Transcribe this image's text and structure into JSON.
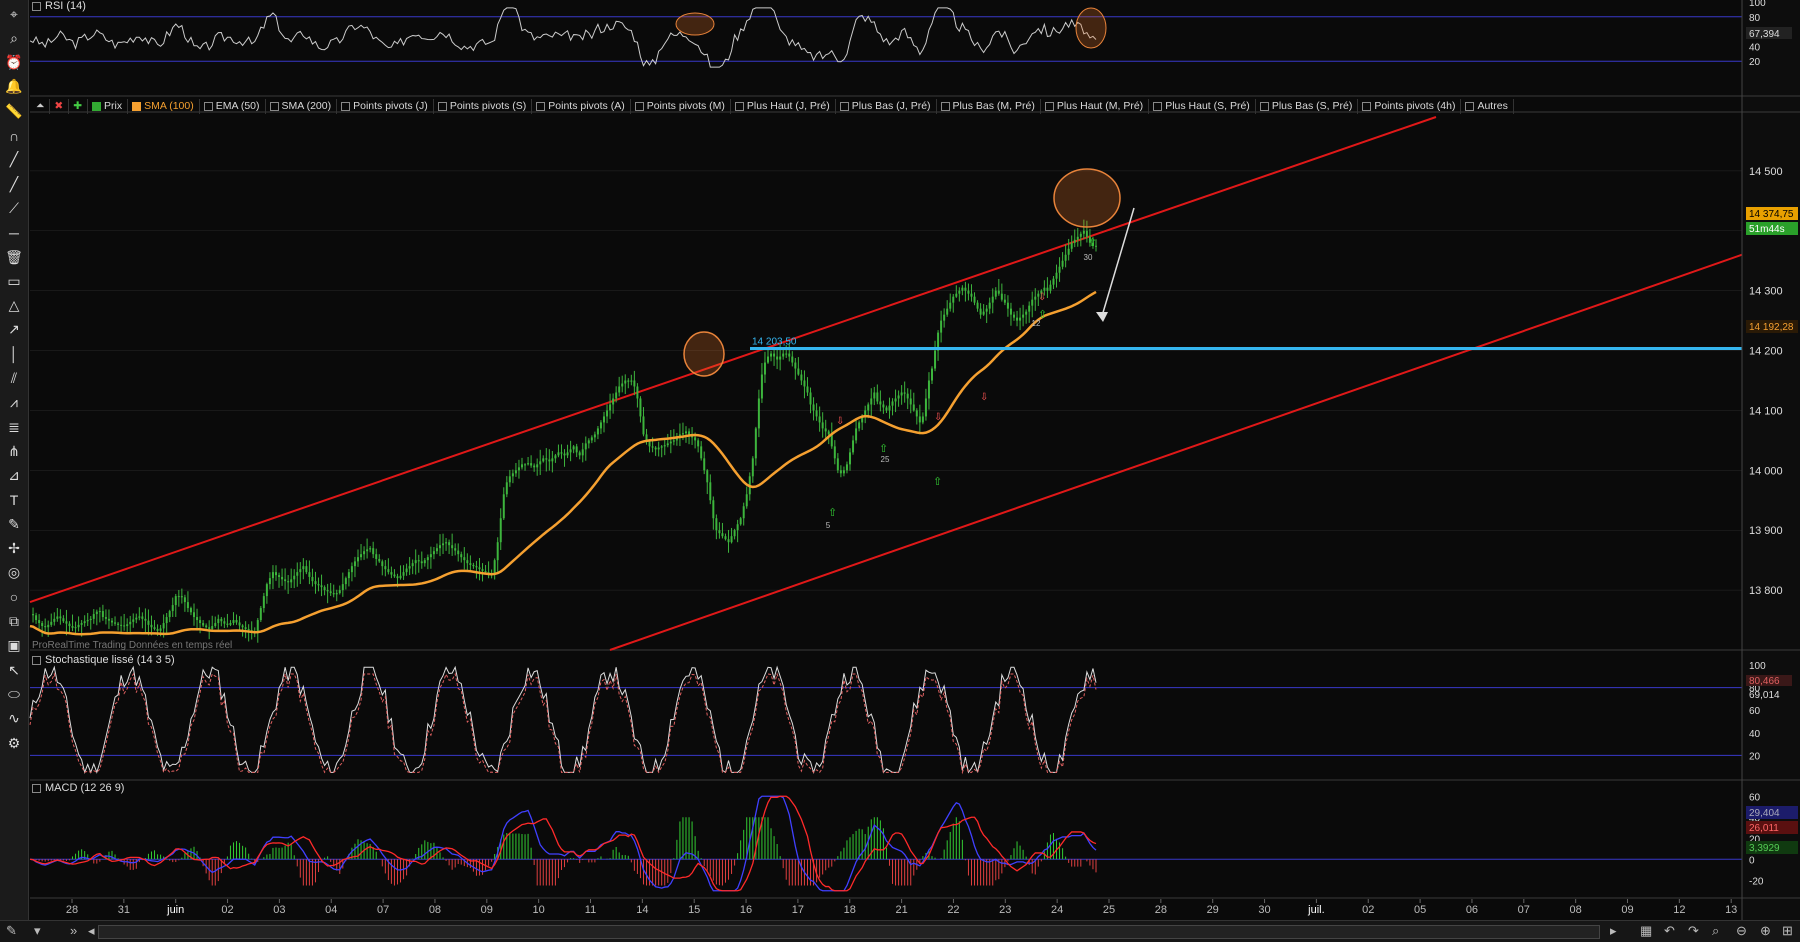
{
  "app": {
    "watermark": "ProRealTime Trading  Données en temps réel"
  },
  "toolbar": {
    "icons": [
      "pointer-icon",
      "magnifier-icon",
      "alarm-icon",
      "bell-icon",
      "ruler-icon",
      "magnet-icon",
      "line-icon",
      "trend-line-icon",
      "ray-icon",
      "horizontal-line-icon",
      "trash-icon",
      "rectangle-icon",
      "triangle-icon",
      "arrow-icon",
      "vertical-line-icon",
      "channel-icon",
      "zigzag-icon",
      "fibonacci-icon",
      "pitchfork-icon",
      "gann-icon",
      "text-icon",
      "brush-icon",
      "cross-icon",
      "spiral-icon",
      "circle-icon",
      "copy-icon",
      "label-icon",
      "cursor-icon",
      "ellipse-icon",
      "wave-icon",
      "settings-icon"
    ]
  },
  "legend": [
    {
      "label": "Prix",
      "on": "green"
    },
    {
      "label": "SMA (100)",
      "on": "orange"
    },
    {
      "label": "EMA (50)",
      "on": ""
    },
    {
      "label": "SMA (200)",
      "on": ""
    },
    {
      "label": "Points pivots (J)",
      "on": ""
    },
    {
      "label": "Points pivots (S)",
      "on": ""
    },
    {
      "label": "Points pivots (A)",
      "on": ""
    },
    {
      "label": "Points pivots (M)",
      "on": ""
    },
    {
      "label": "Plus Haut (J, Pré)",
      "on": ""
    },
    {
      "label": "Plus Bas (J, Pré)",
      "on": ""
    },
    {
      "label": "Plus Bas (M, Pré)",
      "on": ""
    },
    {
      "label": "Plus Haut (M, Pré)",
      "on": ""
    },
    {
      "label": "Plus Haut (S, Pré)",
      "on": ""
    },
    {
      "label": "Plus Bas (S, Pré)",
      "on": ""
    },
    {
      "label": "Points pivots (4h)",
      "on": ""
    },
    {
      "label": "Autres",
      "on": ""
    }
  ],
  "colors": {
    "bg": "#0a0a0a",
    "grid": "#2a2a2a",
    "channel": "#e01818",
    "sma": "#f5a030",
    "resistance": "#35b6f0",
    "candle": "#3db53d",
    "rsi": "#cccccc",
    "band": "#3838c8"
  },
  "chart_data": [
    {
      "id": "price",
      "type": "line",
      "title": "",
      "ylim": [
        13700,
        14590
      ],
      "yticks": [
        "14 500",
        "14 400",
        "14 300",
        "14 200",
        "14 100",
        "14 000",
        "13 900",
        "13 800"
      ],
      "ytick_values": [
        14500,
        14400,
        14300,
        14200,
        14100,
        14000,
        13900,
        13800
      ],
      "xlabels": [
        "28",
        "31",
        "juin",
        "02",
        "03",
        "04",
        "07",
        "08",
        "09",
        "10",
        "11",
        "14",
        "15",
        "16",
        "17",
        "18",
        "21",
        "22",
        "23",
        "24",
        "25",
        "28",
        "29",
        "30",
        "juil.",
        "02",
        "05",
        "06",
        "07",
        "08",
        "09",
        "12",
        "13"
      ],
      "series": [
        {
          "name": "Prix",
          "type": "candlestick",
          "x": [
            0,
            1,
            2,
            3,
            4,
            5,
            6,
            7,
            8,
            9,
            10,
            11,
            12,
            13,
            14,
            15,
            16,
            17,
            18,
            19,
            20,
            21,
            22,
            23,
            24,
            25,
            26,
            27,
            28,
            29,
            30,
            31,
            32,
            33,
            34,
            35,
            36,
            37,
            38,
            39,
            40,
            41,
            42,
            43,
            44,
            45,
            46,
            47,
            48,
            49,
            50,
            51,
            52,
            53,
            54,
            55,
            56,
            57,
            58,
            59,
            60,
            61,
            62,
            63,
            64,
            65,
            66,
            67,
            68,
            69,
            70,
            71,
            72,
            73,
            74,
            75,
            76,
            77,
            78,
            79,
            80,
            81,
            82,
            83,
            84,
            85,
            86,
            87,
            88,
            89,
            90,
            91,
            92,
            93,
            94,
            95,
            96,
            97,
            98,
            99,
            100,
            101,
            102,
            103,
            104,
            105,
            106,
            107,
            108,
            109,
            110,
            111,
            112,
            113,
            114,
            115,
            116,
            117,
            118,
            119,
            120,
            121,
            122,
            123,
            124,
            125,
            126,
            127,
            128,
            129,
            130,
            131,
            132,
            133,
            134,
            135,
            136,
            137,
            138,
            139,
            140,
            141,
            142,
            143,
            144,
            145,
            146,
            147,
            148,
            149,
            150,
            151,
            152,
            153,
            154,
            155,
            156,
            157,
            158,
            159,
            160,
            161,
            162,
            163,
            164,
            165,
            166,
            167,
            168,
            169,
            170,
            171,
            172,
            173,
            174,
            175,
            176,
            177,
            178,
            179,
            180,
            181,
            182,
            183,
            184,
            185,
            186,
            187,
            188,
            189,
            190,
            191,
            192,
            193,
            194,
            195,
            196,
            197,
            198,
            199,
            200,
            201,
            202,
            203,
            204,
            205,
            206,
            207,
            208,
            209,
            210,
            211,
            212,
            213,
            214,
            215,
            216,
            217,
            218,
            219,
            220,
            221,
            222,
            223,
            224,
            225,
            226,
            227,
            228,
            229,
            230,
            231,
            232,
            233,
            234,
            235,
            236,
            237,
            238,
            239,
            240,
            241,
            242,
            243,
            244,
            245,
            246,
            247,
            248,
            249,
            250,
            251,
            252,
            253,
            254,
            255,
            256,
            257,
            258,
            259,
            260,
            261,
            262,
            263,
            264,
            265,
            266,
            267,
            268,
            269,
            270,
            271,
            272,
            273,
            274,
            275,
            276,
            277,
            278,
            279,
            280,
            281,
            282,
            283,
            284,
            285,
            286,
            287,
            288,
            289,
            290,
            291,
            292,
            293,
            294,
            295,
            296,
            297,
            298,
            299,
            300,
            301,
            302,
            303,
            304,
            305,
            306,
            307,
            308,
            309,
            310,
            311,
            312,
            313,
            314,
            315,
            316,
            317,
            318,
            319,
            320,
            321,
            322,
            323,
            324,
            325,
            326,
            327,
            328,
            329,
            330,
            331,
            332,
            333,
            334,
            335,
            336,
            337,
            338,
            339,
            340,
            341,
            342,
            343,
            344,
            345,
            346,
            347,
            348,
            349,
            350,
            351,
            352,
            353,
            354,
            355,
            356,
            357,
            358,
            359,
            360,
            361,
            362,
            363,
            364,
            365,
            366,
            367,
            368,
            369,
            370,
            371,
            372,
            373,
            374,
            375,
            376,
            377,
            378,
            379,
            380,
            381,
            382,
            383,
            384,
            385,
            386,
            387,
            388,
            389,
            390,
            391,
            392,
            393,
            394,
            395,
            396,
            397,
            398,
            399,
            400
          ],
          "close": [
            13760,
            13758,
            13750,
            13745,
            13740,
            13738,
            13742,
            13747,
            13752,
            13756,
            13753,
            13748,
            13744,
            13740,
            13737,
            13738,
            13742,
            13745,
            13748,
            13750,
            13752,
            13760,
            13764,
            13765,
            13755,
            13752,
            13749,
            13746,
            13744,
            13742,
            13741,
            13740,
            13743,
            13747,
            13751,
            13754,
            13756,
            13752,
            13749,
            13742,
            13738,
            13735,
            13732,
            13736,
            13745,
            13755,
            13765,
            13775,
            13790,
            13790,
            13788,
            13780,
            13770,
            13763,
            13755,
            13750,
            13745,
            13741,
            13738,
            13735,
            13740,
            13745,
            13752,
            13748,
            13744,
            13742,
            13745,
            13750,
            13746,
            13741,
            13738,
            13735,
            13733,
            13731,
            13730,
            13750,
            13770,
            13790,
            13810,
            13820,
            13830,
            13825,
            13822,
            13818,
            13815,
            13813,
            13818,
            13824,
            13830,
            13835,
            13840,
            13830,
            13822,
            13815,
            13810,
            13808,
            13805,
            13800,
            13798,
            13795,
            13793,
            13795,
            13800,
            13810,
            13820,
            13830,
            13840,
            13848,
            13855,
            13860,
            13865,
            13868,
            13870,
            13860,
            13852,
            13848,
            13840,
            13835,
            13830,
            13826,
            13823,
            13820,
            13824,
            13830,
            13836,
            13840,
            13845,
            13850,
            13848,
            13845,
            13850,
            13855,
            13860,
            13865,
            13870,
            13875,
            13878,
            13880,
            13875,
            13870,
            13866,
            13860,
            13855,
            13850,
            13845,
            13842,
            13840,
            13838,
            13835,
            13832,
            13830,
            13828,
            13826,
            13850,
            13880,
            13920,
            13960,
            13980,
            13990,
            13995,
            14000,
            14005,
            14010,
            14010,
            14012,
            14008,
            14005,
            14010,
            14015,
            14020,
            14018,
            14015,
            14020,
            14025,
            14030,
            14028,
            14025,
            14030,
            14035,
            14040,
            14030,
            14025,
            14035,
            14045,
            14050,
            14055,
            14060,
            14070,
            14080,
            14090,
            14100,
            14110,
            14120,
            14130,
            14140,
            14145,
            14150,
            14148,
            14150,
            14140,
            14120,
            14090,
            14060,
            14050,
            14040,
            14038,
            14035,
            14038,
            14040,
            14042,
            14045,
            14048,
            14050,
            14055,
            14060,
            14062,
            14065,
            14060,
            14055,
            14050,
            14040,
            14020,
            14000,
            13980,
            13950,
            13920,
            13900,
            13895,
            13890,
            13885,
            13880,
            13890,
            13900,
            13910,
            13920,
            13940,
            13960,
            13990,
            14020,
            14070,
            14120,
            14160,
            14180,
            14190,
            14195,
            14190,
            14185,
            14190,
            14195,
            14195,
            14190,
            14180,
            14170,
            14160,
            14150,
            14140,
            14130,
            14110,
            14100,
            14090,
            14080,
            14070,
            14065,
            14060,
            14040,
            14020,
            14000,
            13995,
            14000,
            14010,
            14030,
            14050,
            14070,
            14080,
            14090,
            14100,
            14110,
            14120,
            14130,
            14115,
            14110,
            14105,
            14100,
            14108,
            14115,
            14120,
            14125,
            14130,
            14128,
            14120,
            14110,
            14100,
            14090,
            14080,
            14090,
            14120,
            14150,
            14170,
            14200,
            14230,
            14250,
            14260,
            14270,
            14280,
            14290,
            14295,
            14300,
            14305,
            14300,
            14295,
            14290,
            14280,
            14270,
            14260,
            14265,
            14270,
            14280,
            14290,
            14300,
            14295,
            14285,
            14280,
            14270,
            14260,
            14255,
            14250,
            14255,
            14260,
            14265,
            14275,
            14285,
            14290,
            14295,
            14300,
            14305,
            14300,
            14310,
            14320,
            14330,
            14340,
            14350,
            14360,
            14370,
            14380,
            14385,
            14390,
            14395,
            14400,
            14390,
            14380,
            14375,
            14374.75
          ],
          "color": "#3db53d"
        },
        {
          "name": "SMA (100)",
          "type": "line",
          "color": "#f5a030"
        },
        {
          "name": "channel-upper",
          "type": "line",
          "color": "#e01818",
          "points": [
            [
              0,
              13780
            ],
            [
              400,
              14460
            ]
          ]
        },
        {
          "name": "channel-lower",
          "type": "line",
          "color": "#e01818"
        },
        {
          "name": "resistance",
          "type": "hline",
          "value": 14203.5,
          "color": "#35b6f0"
        }
      ],
      "annotations": {
        "resistance_label": "14 203,50",
        "price_tag": "14 374,75",
        "timer": "51m44s",
        "sma_tag": "14 192,28",
        "marker_labels": [
          "5",
          "25",
          "12",
          "30"
        ]
      }
    },
    {
      "id": "rsi",
      "type": "line",
      "title": "RSI (14)",
      "ylim": [
        0,
        100
      ],
      "yticks": [
        "100",
        "80",
        "60",
        "40",
        "20"
      ],
      "ytick_values": [
        100,
        80,
        60,
        40,
        20
      ],
      "bands": [
        80,
        20
      ],
      "last_value": "67,394",
      "color": "#cccccc"
    },
    {
      "id": "stoch",
      "type": "line",
      "title": "Stochastique lissé (14 3 5)",
      "ylim": [
        0,
        100
      ],
      "yticks": [
        "100",
        "80",
        "60",
        "40",
        "20"
      ],
      "ytick_values": [
        100,
        80,
        60,
        40,
        20
      ],
      "bands": [
        80,
        20
      ],
      "last_values": [
        "80,466",
        "69,014"
      ]
    },
    {
      "id": "macd",
      "type": "bar",
      "title": "MACD (12 26 9)",
      "ylim": [
        -35,
        65
      ],
      "yticks": [
        "60",
        "40",
        "20",
        "0",
        "-20"
      ],
      "ytick_values": [
        60,
        40,
        20,
        0,
        -20
      ],
      "last_values": [
        "29,404",
        "26,011",
        "3,3929"
      ]
    }
  ],
  "statusbar": {
    "items": [
      "pencil-icon",
      "menu-icon",
      "double-chevron-icon",
      "scroll-left-icon",
      "scroll-right-icon",
      "calendar-icon",
      "undo-icon",
      "redo-icon",
      "zoom-icon",
      "zoom-out-icon",
      "zoom-in-icon",
      "fit-icon"
    ]
  }
}
